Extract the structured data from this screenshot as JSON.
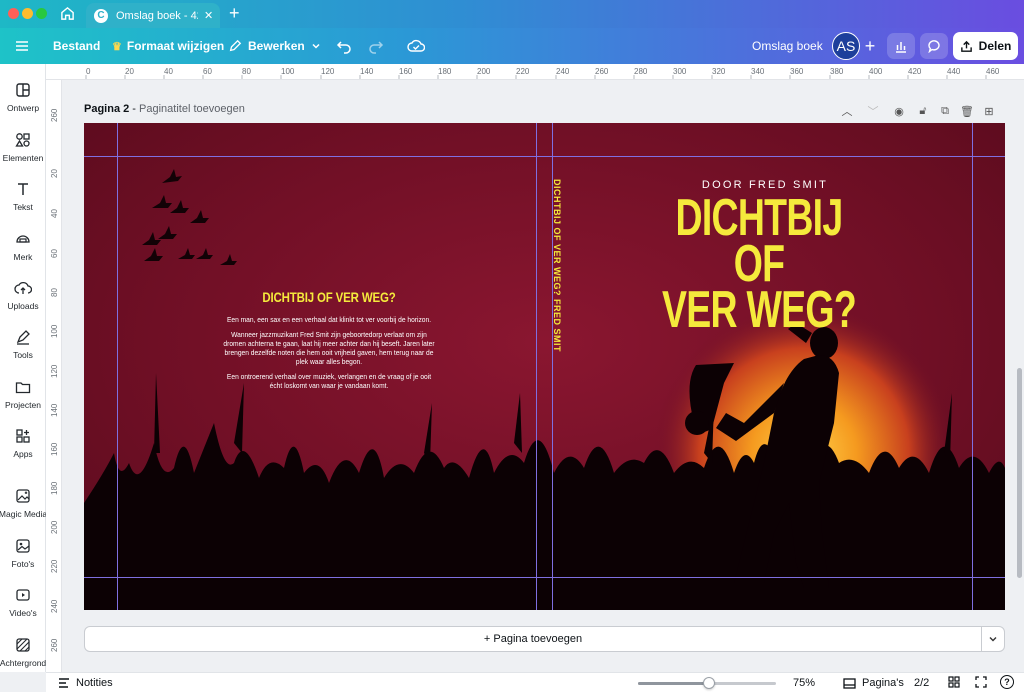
{
  "browser": {
    "tab_title": "Omslag boek - 427...",
    "favicon_letter": "C"
  },
  "toolbar": {
    "file_label": "Bestand",
    "resize_label": "Formaat wijzigen",
    "edit_label": "Bewerken",
    "doc_title": "Omslag boek",
    "avatar_initials": "AS",
    "share_label": "Delen"
  },
  "sidebar": {
    "items": [
      {
        "label": "Ontwerp",
        "icon": "layout-icon"
      },
      {
        "label": "Elementen",
        "icon": "shapes-icon"
      },
      {
        "label": "Tekst",
        "icon": "text-icon"
      },
      {
        "label": "Merk",
        "icon": "brand-icon"
      },
      {
        "label": "Uploads",
        "icon": "upload-cloud-icon"
      },
      {
        "label": "Tools",
        "icon": "pen-tool-icon"
      },
      {
        "label": "Projecten",
        "icon": "folder-icon"
      },
      {
        "label": "Apps",
        "icon": "apps-icon"
      },
      {
        "label": "Magic Media",
        "icon": "magic-image-icon"
      },
      {
        "label": "Foto's",
        "icon": "photo-icon"
      },
      {
        "label": "Video's",
        "icon": "video-icon"
      },
      {
        "label": "Achtergrond",
        "icon": "background-pattern-icon"
      }
    ]
  },
  "rulers": {
    "top": [
      "0",
      "20",
      "40",
      "60",
      "80",
      "100",
      "120",
      "140",
      "160",
      "180",
      "200",
      "220",
      "240",
      "260",
      "280",
      "300",
      "320",
      "340",
      "360",
      "380",
      "400",
      "420",
      "440",
      "460"
    ],
    "left": [
      "260",
      "20",
      "40",
      "60",
      "80",
      "100",
      "120",
      "140",
      "160",
      "180",
      "200",
      "220",
      "240",
      "260"
    ]
  },
  "page": {
    "label": "Pagina 2",
    "separator": " - ",
    "title_placeholder": "Paginatitel toevoegen"
  },
  "cover": {
    "back": {
      "title": "DICHTBIJ OF VER WEG?",
      "p1": "Een man, een sax en een verhaal dat klinkt tot ver voorbij de horizon.",
      "p2": "Wanneer jazzmuzikant Fred Smit zijn geboortedorp verlaat om zijn dromen achterna te gaan, laat hij meer achter dan hij beseft. Jaren later brengen dezelfde noten die hem ooit vrijheid gaven, hem terug naar de plek waar alles begon.",
      "p3": "Een ontroerend verhaal over muziek, verlangen en de vraag of je ooit écht loskomt van waar je vandaan komt."
    },
    "spine": "DICHTBIJ OF VER WEG? FRED SMIT",
    "front": {
      "byline": "DOOR FRED SMIT",
      "title_line1": "DICHTBIJ OF",
      "title_line2": "VER WEG?"
    },
    "colors": {
      "background": "#6f0f25",
      "title": "#f5ea3c",
      "sun": "#f59a1f"
    }
  },
  "add_page_label": "+ Pagina toevoegen",
  "status": {
    "notes_label": "Notities",
    "zoom_value": 75,
    "zoom_label": "75%",
    "pages_label": "Pagina's",
    "page_counter": "2/2",
    "help_label": "?"
  }
}
